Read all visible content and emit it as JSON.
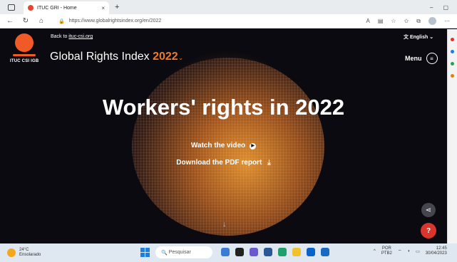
{
  "browser": {
    "tab_title": "ITUC GRI - Home",
    "tab_close": "×",
    "new_tab": "+",
    "url": "https://www.globalrightsindex.org/en/2022",
    "controls": {
      "minimize": "–",
      "maximize": "▢"
    },
    "tool_icons": [
      "Aᴬ",
      "aa",
      "☆",
      "⟲",
      "☆",
      "⧉"
    ]
  },
  "page": {
    "back_link_prefix": "Back to ",
    "back_link": "ituc-csi.org",
    "logo_text": "ITUC CSI IGB",
    "site_title": "Global Rights Index",
    "year": "2022",
    "language": "English",
    "menu_label": "Menu",
    "hero_title": "Workers' rights in 2022",
    "cta_video": "Watch the video",
    "cta_report": "Download the PDF report"
  },
  "taskbar": {
    "temperature": "24°C",
    "weather_desc": "Ensolarado",
    "search_placeholder": "Pesquisar",
    "lang_code": "POR",
    "lang_layout": "PTB2",
    "time": "12:45",
    "date": "30/04/2023"
  },
  "colors": {
    "brand_orange": "#ef7a26",
    "help_red": "#d9352c"
  }
}
